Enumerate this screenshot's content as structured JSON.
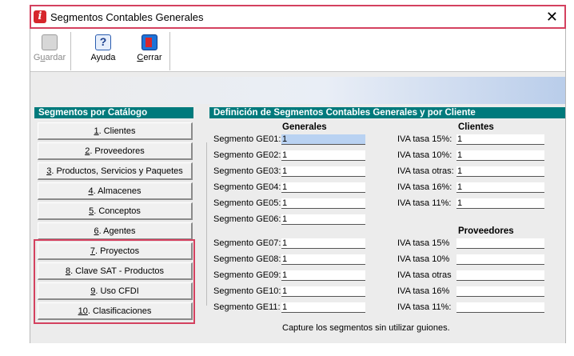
{
  "window": {
    "title": "Segmentos Contables Generales",
    "close_glyph": "✕"
  },
  "toolbar": {
    "save": {
      "label_pre": "G",
      "label_u": "u",
      "label_post": "ardar",
      "icon": "floppy-disk-icon"
    },
    "help": {
      "label": "Ayuda",
      "icon": "question-mark-icon",
      "glyph": "?"
    },
    "close": {
      "label_u": "C",
      "label_post": "errar",
      "icon": "exit-door-icon"
    }
  },
  "catalog": {
    "heading": "Segmentos por Catálogo",
    "items": [
      {
        "num": "1",
        "text": ". Clientes"
      },
      {
        "num": "2",
        "text": ". Proveedores"
      },
      {
        "num": "3",
        "text": ". Productos, Servicios y Paquetes"
      },
      {
        "num": "4",
        "text": ". Almacenes"
      },
      {
        "num": "5",
        "text": ". Conceptos"
      },
      {
        "num": "6",
        "text": ". Agentes"
      },
      {
        "num": "7",
        "text": ". Proyectos"
      },
      {
        "num": "8",
        "text": ". Clave SAT - Productos"
      },
      {
        "num": "9",
        "text": ". Uso CFDI"
      },
      {
        "num": "10",
        "text": ". Clasificaciones"
      }
    ]
  },
  "definition": {
    "heading": "Definición de Segmentos Contables Generales y por Cliente",
    "generales_header": "Generales",
    "clientes_header": "Clientes",
    "proveedores_header": "Proveedores",
    "generales": [
      {
        "label": "Segmento GE01:",
        "value": "1"
      },
      {
        "label": "Segmento GE02:",
        "value": "1"
      },
      {
        "label": "Segmento GE03:",
        "value": "1"
      },
      {
        "label": "Segmento GE04:",
        "value": "1"
      },
      {
        "label": "Segmento GE05:",
        "value": "1"
      },
      {
        "label": "Segmento GE06:",
        "value": "1"
      },
      {
        "label": "Segmento GE07:",
        "value": "1"
      },
      {
        "label": "Segmento GE08:",
        "value": "1"
      },
      {
        "label": "Segmento GE09:",
        "value": "1"
      },
      {
        "label": "Segmento GE10:",
        "value": "1"
      },
      {
        "label": "Segmento GE11:",
        "value": "1"
      }
    ],
    "clientes": [
      {
        "label": "IVA tasa 15%:",
        "value": "1"
      },
      {
        "label": "IVA tasa 10%:",
        "value": "1"
      },
      {
        "label": "IVA tasa otras:",
        "value": "1"
      },
      {
        "label": "IVA tasa 16%:",
        "value": "1"
      },
      {
        "label": "IVA tasa 11%:",
        "value": "1"
      }
    ],
    "proveedores": [
      {
        "label": "IVA tasa 15%",
        "value": ""
      },
      {
        "label": "IVA tasa 10%",
        "value": ""
      },
      {
        "label": "IVA tasa otras",
        "value": ""
      },
      {
        "label": "IVA tasa 16%",
        "value": ""
      },
      {
        "label": "IVA tasa 11%:",
        "value": ""
      }
    ],
    "footer_note": "Capture los segmentos sin utilizar guiones."
  },
  "colors": {
    "accent_red": "#d4415f",
    "section_teal": "#007a7c",
    "selected_field": "#b9d2f2"
  }
}
